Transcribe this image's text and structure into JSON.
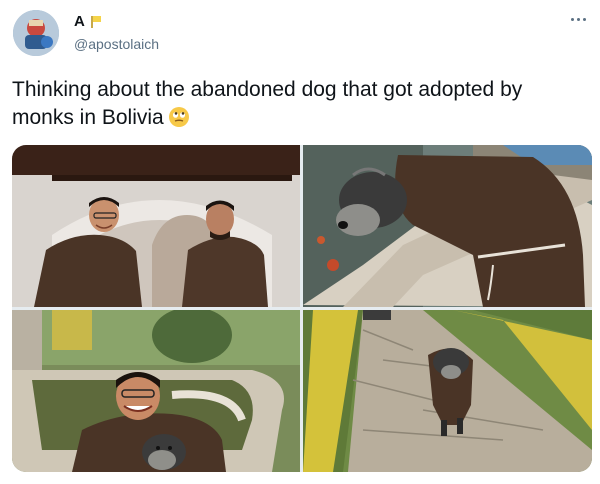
{
  "tweet": {
    "display_name": "A",
    "handle": "@apostolaich",
    "text": "Thinking about the abandoned dog that got adopted by monks in Bolivia",
    "emoji": "face-with-rolling-eyes",
    "icons": {
      "more": "more-icon",
      "name_badge": "yellow-flag-emoji"
    }
  },
  "media": {
    "photo_count": 4,
    "photos": [
      {
        "subject": "two monks in brown habits under an arch"
      },
      {
        "subject": "schnauzer dog in brown monk robe leaning on stone railing"
      },
      {
        "subject": "smiling monk holding dog by fountain"
      },
      {
        "subject": "dog in robe walking on stone garden path"
      }
    ]
  },
  "colors": {
    "text": "#0f1419",
    "secondary": "#5b7083",
    "robe": "#4a3426"
  }
}
